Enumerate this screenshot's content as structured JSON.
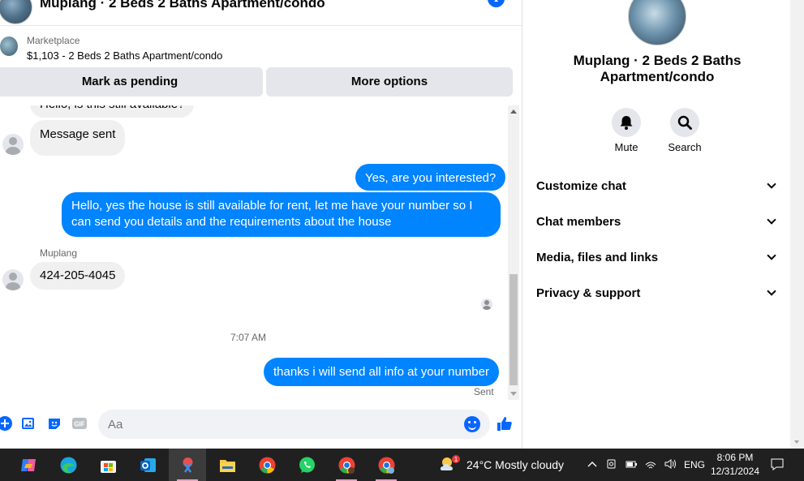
{
  "header": {
    "title": "Muplang · 2 Beds 2 Baths Apartment/condo"
  },
  "listing": {
    "source": "Marketplace",
    "title": "$1,103 - 2 Beds 2 Baths Apartment/condo",
    "mark_pending_label": "Mark as pending",
    "more_options_label": "More options"
  },
  "messages": {
    "cut_off_message": "Hello, is this still available?",
    "auto_reply": "Message sent",
    "out_1": "Yes, are you interested?",
    "out_2": "Hello, yes the house is still available for rent, let me have your number so I can send you details and the requirements about the house",
    "sender_name": "Muplang",
    "in_phone": "424-205-4045",
    "time_divider": "7:07 AM",
    "out_3": "thanks i will send all info at your number",
    "sent_status": "Sent"
  },
  "composer": {
    "placeholder": "Aa",
    "gif_label": "GIF"
  },
  "info_panel": {
    "title": "Muplang · 2 Beds 2 Baths Apartment/condo",
    "mute_label": "Mute",
    "search_label": "Search",
    "sections": [
      "Customize chat",
      "Chat members",
      "Media, files and links",
      "Privacy & support"
    ]
  },
  "taskbar": {
    "weather": "24°C  Mostly cloudy",
    "weather_badge": "1",
    "language": "ENG",
    "time": "8:06 PM",
    "date": "12/31/2024"
  },
  "colors": {
    "accent": "#0866ff",
    "outgoing_bubble": "#0084ff",
    "incoming_bubble": "#f0f0f0",
    "taskbar": "#202020"
  }
}
